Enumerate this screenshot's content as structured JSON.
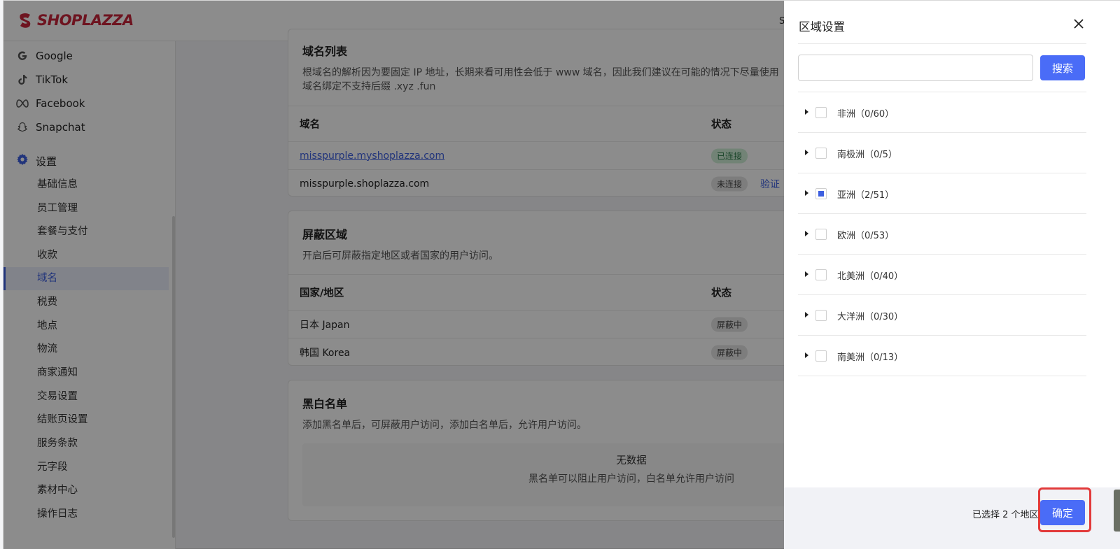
{
  "topbar": {
    "logo_text": "SHOPLAZZA",
    "shop_label": "Shop"
  },
  "sidebar": {
    "channels": [
      {
        "label": "Google",
        "icon": "google-icon"
      },
      {
        "label": "TikTok",
        "icon": "tiktok-icon"
      },
      {
        "label": "Facebook",
        "icon": "meta-icon"
      },
      {
        "label": "Snapchat",
        "icon": "snapchat-icon"
      }
    ],
    "settings_label": "设置",
    "settings_items": [
      "基础信息",
      "员工管理",
      "套餐与支付",
      "收款",
      "域名",
      "税费",
      "地点",
      "物流",
      "商家通知",
      "交易设置",
      "结账页设置",
      "服务条款",
      "元字段",
      "素材中心",
      "操作日志"
    ],
    "active_item": "域名"
  },
  "domain_card": {
    "title": "域名列表",
    "desc_line1": "根域名的解析因为要固定 IP 地址，长期来看可用性会低于 www 域名，因此我们建议在可能的情况下尽量使用",
    "desc_line2": "域名绑定不支持后缀 .xyz .fun",
    "col_domain": "域名",
    "col_status": "状态",
    "rows": [
      {
        "domain": "misspurple.myshoplazza.com",
        "status": "已连接"
      },
      {
        "domain": "misspurple.shoplazza.com",
        "status": "未连接",
        "action": "验证"
      }
    ]
  },
  "block_card": {
    "title": "屏蔽区域",
    "desc": "开启后可屏蔽指定地区或者国家的用户访问。",
    "col_region": "国家/地区",
    "col_status": "状态",
    "rows": [
      {
        "region": "日本 Japan",
        "status": "屏蔽中"
      },
      {
        "region": "韩国 Korea",
        "status": "屏蔽中"
      }
    ]
  },
  "list_card": {
    "title": "黑白名单",
    "desc": "添加黑名单后，可屏蔽用户访问，添加白名单后，允许用户访问。",
    "empty_title": "无数据",
    "empty_sub": "黑名单可以阻止用户访问，白名单允许用户访问"
  },
  "drawer": {
    "title": "区域设置",
    "search_placeholder": "",
    "search_button": "搜索",
    "regions": [
      {
        "label": "非洲（0/60）",
        "state": "unchecked"
      },
      {
        "label": "南极洲（0/5）",
        "state": "unchecked"
      },
      {
        "label": "亚洲（2/51）",
        "state": "partial"
      },
      {
        "label": "欧洲（0/53）",
        "state": "unchecked"
      },
      {
        "label": "北美洲（0/40）",
        "state": "unchecked"
      },
      {
        "label": "大洋洲（0/30）",
        "state": "unchecked"
      },
      {
        "label": "南美洲（0/13）",
        "state": "unchecked"
      }
    ],
    "selected_count": "已选择 2 个地区",
    "confirm_button": "确定"
  },
  "colors": {
    "primary": "#4a6cf7",
    "brand": "#c8253b",
    "highlight": "#e23a3a"
  }
}
